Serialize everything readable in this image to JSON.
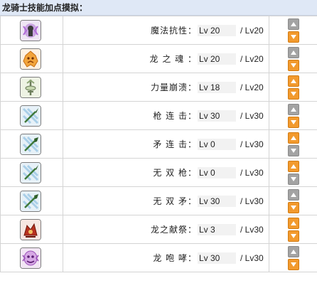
{
  "panel": {
    "title": "龙骑士技能加点摸拟："
  },
  "colors": {
    "active_button": "#f29a2e",
    "disabled_button": "#a3a3a3",
    "header_bg": "#dfe8f6"
  },
  "skills": [
    {
      "name": "魔法抗性：",
      "level": "Lv 20",
      "max": "/ Lv20",
      "icon": "magic-resistance-icon",
      "up_enabled": false,
      "down_enabled": true
    },
    {
      "name": "龙 之 魂 ：",
      "level": "Lv 20",
      "max": "/ Lv20",
      "icon": "dragon-soul-icon",
      "up_enabled": false,
      "down_enabled": true
    },
    {
      "name": "力量崩溃：",
      "level": "Lv 18",
      "max": "/ Lv20",
      "icon": "power-crash-icon",
      "up_enabled": true,
      "down_enabled": true
    },
    {
      "name": "枪 连 击：",
      "level": "Lv 30",
      "max": "/ Lv30",
      "icon": "spear-crusher-icon",
      "up_enabled": false,
      "down_enabled": true
    },
    {
      "name": "矛 连 击：",
      "level": "Lv 0",
      "max": "/ Lv30",
      "icon": "polearm-crusher-icon",
      "up_enabled": true,
      "down_enabled": false
    },
    {
      "name": "无 双 枪：",
      "level": "Lv 0",
      "max": "/ Lv30",
      "icon": "spear-fury-icon",
      "up_enabled": true,
      "down_enabled": false
    },
    {
      "name": "无 双 矛：",
      "level": "Lv 30",
      "max": "/ Lv30",
      "icon": "polearm-fury-icon",
      "up_enabled": false,
      "down_enabled": true
    },
    {
      "name": "龙之献祭：",
      "level": "Lv 3",
      "max": "/ Lv30",
      "icon": "sacrifice-icon",
      "up_enabled": true,
      "down_enabled": true
    },
    {
      "name": "龙 咆 哮：",
      "level": "Lv 30",
      "max": "/ Lv30",
      "icon": "dragon-roar-icon",
      "up_enabled": false,
      "down_enabled": true
    }
  ]
}
